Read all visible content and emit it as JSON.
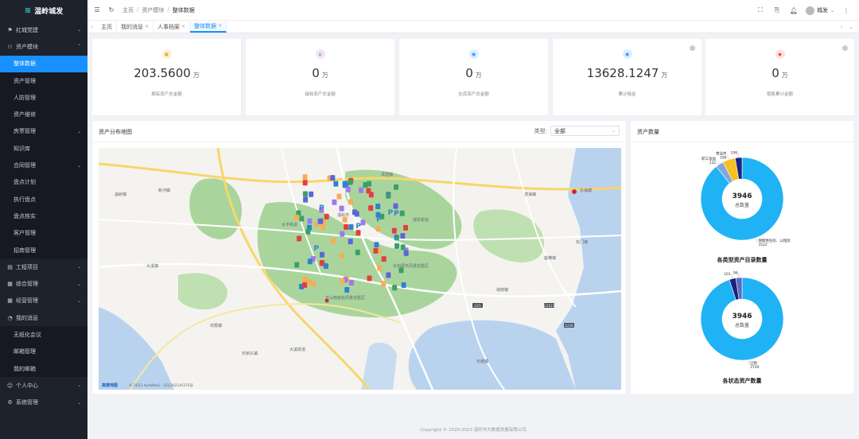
{
  "app": {
    "title": "温岭城发"
  },
  "sidebar": {
    "items": [
      {
        "icon": "flag-icon",
        "label": "红城党建",
        "arrow": "⌄"
      },
      {
        "icon": "person-icon",
        "label": "资产模块",
        "arrow": "⌃"
      },
      {
        "label": "整体数据",
        "active": true
      },
      {
        "label": "资产管理"
      },
      {
        "label": "人防管理"
      },
      {
        "label": "资产维修"
      },
      {
        "label": "房票管理",
        "arrow": "⌄"
      },
      {
        "label": "知识库"
      },
      {
        "label": "合同管理",
        "arrow": "⌄"
      },
      {
        "label": "盘点计划"
      },
      {
        "label": "执行盘点"
      },
      {
        "label": "盘点核实"
      },
      {
        "label": "客户管理"
      },
      {
        "label": "招商管理"
      },
      {
        "icon": "document-icon",
        "label": "工程项目",
        "arrow": "⌄"
      },
      {
        "icon": "grid-icon",
        "label": "综合管理",
        "arrow": "⌄"
      },
      {
        "icon": "grid-icon",
        "label": "经营管理",
        "arrow": "⌄"
      },
      {
        "icon": "bell-icon",
        "label": "我的消息"
      },
      {
        "label": "无纸化会议"
      },
      {
        "label": "邮箱管理"
      },
      {
        "label": "我的邮箱"
      },
      {
        "icon": "user-icon",
        "label": "个人中心",
        "arrow": "⌄"
      },
      {
        "icon": "gear-icon",
        "label": "系统管理",
        "arrow": "⌄"
      }
    ]
  },
  "header": {
    "breadcrumb": [
      "主页",
      "资产模块",
      "整体数据"
    ],
    "user": "城发"
  },
  "tabs": [
    {
      "label": "主页",
      "closable": false
    },
    {
      "label": "我的消息",
      "closable": true
    },
    {
      "label": "人事档案",
      "closable": true
    },
    {
      "label": "整体数据",
      "closable": true,
      "active": true
    }
  ],
  "stats": [
    {
      "icon": "briefcase-icon",
      "color": "#f5a623",
      "bg": "#fdf0d9",
      "value": "203.5600",
      "unit": "万",
      "label": "拥有资产总金额"
    },
    {
      "icon": "home-icon",
      "color": "#9b59b6",
      "bg": "#efe3f7",
      "value": "0",
      "unit": "万",
      "label": "接收资产总金额"
    },
    {
      "icon": "database-icon",
      "color": "#1890ff",
      "bg": "#dcefff",
      "value": "0",
      "unit": "万",
      "label": "在库资产总金额"
    },
    {
      "icon": "database-icon",
      "color": "#1890ff",
      "bg": "#dcefff",
      "value": "13628.1247",
      "unit": "万",
      "label": "累计租金"
    },
    {
      "icon": "tag-icon",
      "color": "#e74c3c",
      "bg": "#fde3e1",
      "value": "0",
      "unit": "万",
      "label": "销售累计金额"
    }
  ],
  "map_panel": {
    "title": "资产分布地图",
    "type_label": "类型:",
    "type_value": "全部",
    "attribution": "© 2023 AutoNavi - GS(2021)6375号",
    "brand": "高德地图",
    "places": [
      "东海塘",
      "温岭市",
      "太平街道",
      "城东街道",
      "新河镇",
      "大溪镇",
      "石塘镇",
      "箬横镇",
      "泽国镇",
      "滨海镇",
      "松门镇",
      "坞根镇",
      "温峤镇",
      "城南镇",
      "石桥头镇",
      "方山南嵩岩风景名胜区",
      "大溪街道",
      "长屿硐天风景名胜区"
    ],
    "road_labels": [
      "G15",
      "G1523",
      "S226"
    ]
  },
  "chart_panel": {
    "title": "资产数量"
  },
  "chart_data": [
    {
      "type": "pie",
      "title": "各类型资产目录数量",
      "center_value": "3946",
      "center_label": "总数量",
      "slices": [
        {
          "name": "保障性住房、公租房",
          "value": 3522,
          "color": "#1fb3f5"
        },
        {
          "name": "职工宿舍",
          "value": 122,
          "color": "#7fa8d8"
        },
        {
          "name": "营业房",
          "value": 196,
          "color": "#f6c022"
        },
        {
          "name": "",
          "value": 106,
          "color": "#1a237e"
        }
      ]
    },
    {
      "type": "pie",
      "title": "各状态资产数量",
      "center_value": "3946",
      "center_label": "总数量",
      "slices": [
        {
          "name": "已租",
          "value": 3749,
          "color": "#1fb3f5"
        },
        {
          "name": "",
          "value": 101,
          "color": "#1a237e"
        },
        {
          "name": "",
          "value": 96,
          "color": "#5c6bc0"
        }
      ]
    }
  ],
  "footer": {
    "text": "Copyright © 2020-2023 温岭市大数据发展有限公司"
  }
}
